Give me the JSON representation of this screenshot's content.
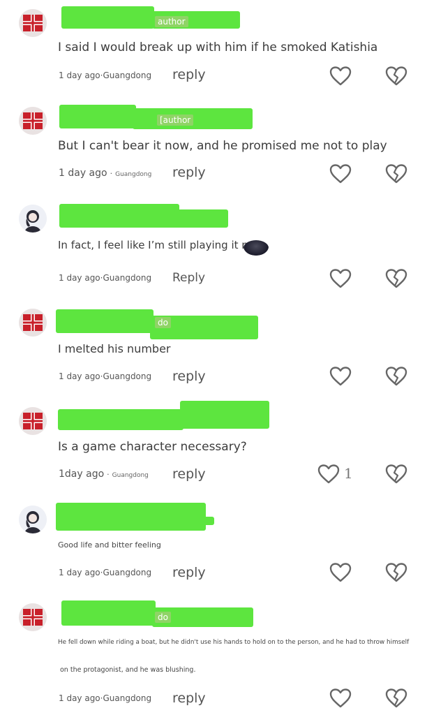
{
  "comments": [
    {
      "tag": "author",
      "text": "I said I would break up with him if he smoked Katishia",
      "meta": "1 day ago·Guangdong",
      "reply": "reply",
      "avatar": "flag-avatar-icon"
    },
    {
      "tag": "[author",
      "text": "But I can't bear it now, and he promised me not to play",
      "meta_time": "1 day ago",
      "meta_sep": "·",
      "meta_loc": "Guangdong",
      "reply": "reply",
      "avatar": "flag-avatar-icon"
    },
    {
      "text": "In fact, I feel like I’m still playing it now.",
      "meta": "1 day ago·Guangdong",
      "reply": "Reply",
      "avatar": "girl-avatar-icon"
    },
    {
      "tag": "do",
      "text": "I melted his number",
      "meta": "1 day ago·Guangdong",
      "reply": "reply",
      "avatar": "flag-avatar-icon"
    },
    {
      "text": "Is a game character necessary?",
      "meta_time": "1day ago",
      "meta_sep": "·",
      "meta_loc": "Guangdong",
      "reply": "reply",
      "likes": "1",
      "avatar": "flag-avatar-icon"
    },
    {
      "text": "Good life and bitter feeling",
      "meta": "1 day ago·Guangdong",
      "reply": "reply",
      "avatar": "girl-avatar-icon"
    },
    {
      "tag": "do",
      "text_line1": "He fell down while riding a boat, but he didn't use his hands to hold on to the person, and he had to throw himself",
      "text_line2": "on the protagonist, and he was blushing.",
      "meta": "1 day ago·Guangdong",
      "reply": "reply",
      "avatar": "flag-avatar-icon"
    }
  ],
  "colors": {
    "redaction": "#5de53f",
    "tag": "#8fd466",
    "text": "#3c3c3c",
    "icon": "#666666"
  }
}
